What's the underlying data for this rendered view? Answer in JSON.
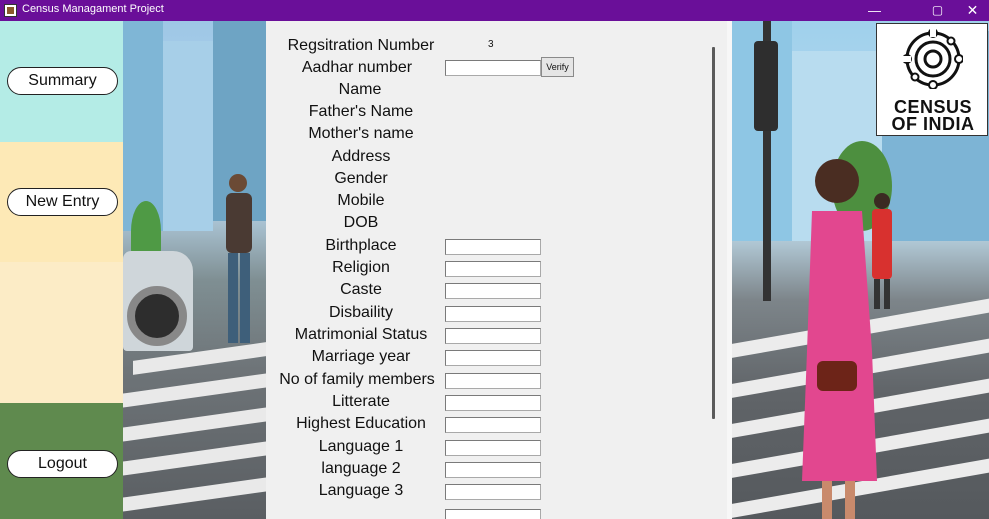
{
  "window": {
    "title": "Census Managament Project",
    "controls": {
      "minimize": "—",
      "maximize": "▢",
      "close": "✕"
    }
  },
  "sidebar": {
    "summary_label": "Summary",
    "new_entry_label": "New Entry",
    "logout_label": "Logout"
  },
  "logo": {
    "line1": "CENSUS",
    "line2": "OF INDIA"
  },
  "form": {
    "registration": {
      "label": "Regsitration Number",
      "value": "3"
    },
    "aadhar": {
      "label": "Aadhar number",
      "value": "",
      "verify_label": "Verify"
    },
    "display_fields": [
      {
        "label": "Name"
      },
      {
        "label": "Father's Name"
      },
      {
        "label": "Mother's name"
      },
      {
        "label": "Address"
      },
      {
        "label": "Gender"
      },
      {
        "label": "Mobile"
      },
      {
        "label": "DOB"
      }
    ],
    "input_fields": [
      {
        "label": "Birthplace",
        "value": ""
      },
      {
        "label": "Religion",
        "value": ""
      },
      {
        "label": "Caste",
        "value": ""
      },
      {
        "label": "Disbaility",
        "value": ""
      },
      {
        "label": "Matrimonial Status",
        "value": ""
      },
      {
        "label": "Marriage year",
        "value": ""
      },
      {
        "label": "No of family members",
        "value": ""
      },
      {
        "label": "Litterate",
        "value": ""
      },
      {
        "label": "Highest Education",
        "value": ""
      },
      {
        "label": "Language 1",
        "value": ""
      },
      {
        "label": "language 2",
        "value": ""
      },
      {
        "label": "Language 3",
        "value": ""
      }
    ]
  },
  "colors": {
    "titlebar": "#6a0f99",
    "sidebar_top": "#b4ece6",
    "sidebar_mid": "#fde9b6",
    "sidebar_bottom": "#5f8a4e",
    "panel": "#f0f0f0"
  }
}
